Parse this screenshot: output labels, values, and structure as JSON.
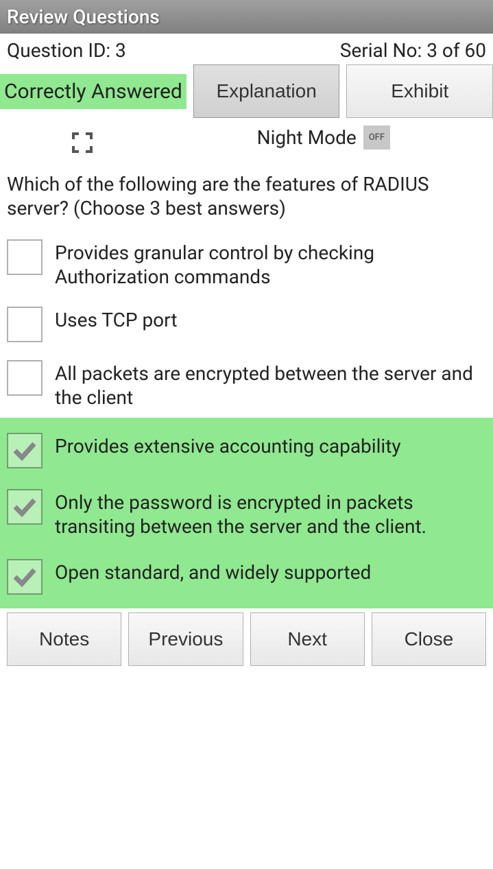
{
  "header": {
    "title": "Review Questions"
  },
  "info": {
    "question_id_label": "Question ID: 3",
    "serial_label": "Serial No: 3 of 60"
  },
  "status": {
    "text": "Correctly Answered"
  },
  "tabs": {
    "explanation": "Explanation",
    "exhibit": "Exhibit"
  },
  "mode": {
    "night_label": "Night Mode",
    "toggle_state": "OFF"
  },
  "question": {
    "text": "Which of the following are the features of RADIUS server? (Choose 3 best answers)"
  },
  "options": [
    {
      "text": "Provides granular control by checking Authorization commands",
      "checked": false,
      "correct": false
    },
    {
      "text": "Uses TCP port",
      "checked": false,
      "correct": false
    },
    {
      "text": "All packets are encrypted between the server and the client",
      "checked": false,
      "correct": false
    },
    {
      "text": "Provides extensive accounting capability",
      "checked": true,
      "correct": true
    },
    {
      "text": "Only the password is encrypted in packets transiting between the server and the client.",
      "checked": true,
      "correct": true
    },
    {
      "text": "Open standard, and widely supported",
      "checked": true,
      "correct": true
    }
  ],
  "footer": {
    "notes": "Notes",
    "previous": "Previous",
    "next": "Next",
    "close": "Close"
  }
}
